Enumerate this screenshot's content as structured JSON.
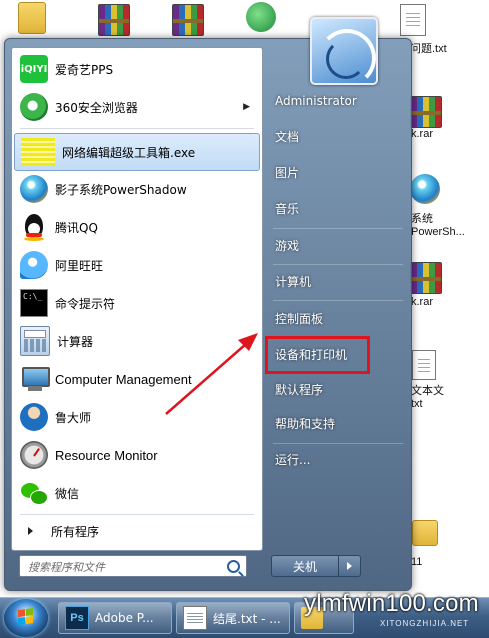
{
  "desktop": {
    "labels": [
      "问题.txt",
      "k.rar",
      "系统",
      "PowerSh...",
      "k.rar",
      "文本文",
      "txt",
      "11"
    ]
  },
  "start_menu": {
    "pinned_programs": [
      {
        "label": "爱奇艺PPS",
        "icon": "iqiyi-icon",
        "has_submenu": false,
        "selected": false
      },
      {
        "label": "360安全浏览器",
        "icon": "360-browser-icon",
        "has_submenu": true,
        "selected": false
      },
      {
        "label": "网络编辑超级工具箱.exe",
        "icon": "toolbox-icon",
        "has_submenu": false,
        "selected": true
      },
      {
        "label": "影子系统PowerShadow",
        "icon": "powershadow-icon",
        "has_submenu": false,
        "selected": false
      },
      {
        "label": "腾讯QQ",
        "icon": "qq-penguin-icon",
        "has_submenu": false,
        "selected": false
      },
      {
        "label": "阿里旺旺",
        "icon": "aliwangwang-icon",
        "has_submenu": false,
        "selected": false
      },
      {
        "label": "命令提示符",
        "icon": "command-prompt-icon",
        "has_submenu": false,
        "selected": false
      },
      {
        "label": "计算器",
        "icon": "calculator-icon",
        "has_submenu": false,
        "selected": false
      },
      {
        "label": "Computer Management",
        "icon": "computer-management-icon",
        "has_submenu": false,
        "selected": false
      },
      {
        "label": "鲁大师",
        "icon": "ludashi-icon",
        "has_submenu": false,
        "selected": false
      },
      {
        "label": "Resource Monitor",
        "icon": "resource-monitor-icon",
        "has_submenu": false,
        "selected": false
      },
      {
        "label": "微信",
        "icon": "wechat-icon",
        "has_submenu": false,
        "selected": false
      }
    ],
    "all_programs_label": "所有程序",
    "search_placeholder": "搜索程序和文件",
    "right_items": [
      {
        "label": "Administrator"
      },
      {
        "label": "文档"
      },
      {
        "label": "图片"
      },
      {
        "label": "音乐"
      },
      {
        "label": "游戏"
      },
      {
        "label": "计算机"
      },
      {
        "label": "控制面板",
        "highlighted": true
      },
      {
        "label": "设备和打印机"
      },
      {
        "label": "默认程序"
      },
      {
        "label": "帮助和支持"
      },
      {
        "label": "运行..."
      }
    ],
    "shutdown_label": "关机",
    "highlight_color": "#e0141c"
  },
  "taskbar": {
    "buttons": [
      {
        "label": "Adobe P...",
        "icon": "photoshop-icon",
        "icon_text": "Ps"
      },
      {
        "label": "结尾.txt - ...",
        "icon": "notepad-icon"
      },
      {
        "label": "",
        "icon": "explorer-icon"
      }
    ]
  },
  "watermark": {
    "text": "ylmfwin100.com",
    "sub_text": "XITONGZHIJIA.NET"
  }
}
